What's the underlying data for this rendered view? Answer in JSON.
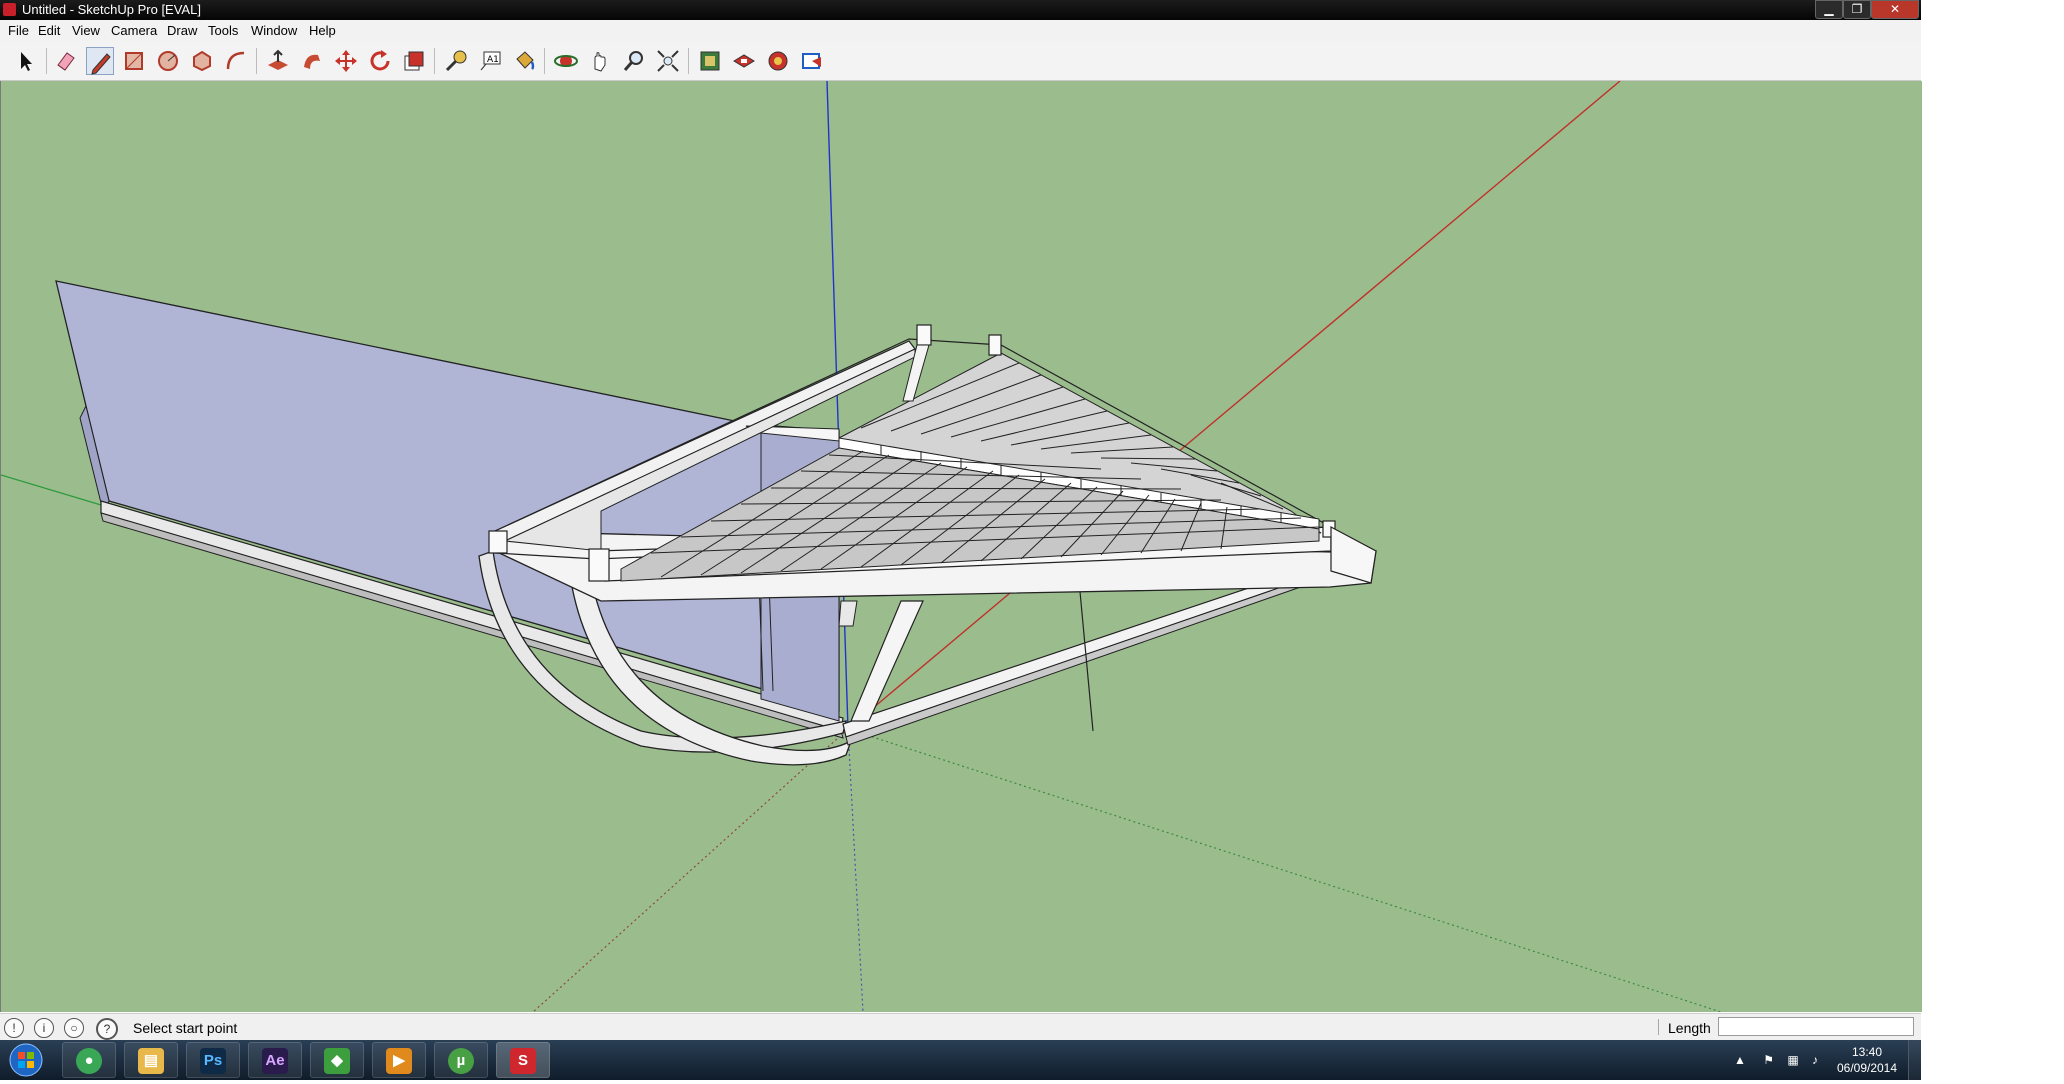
{
  "window": {
    "title": "Untitled - SketchUp Pro [EVAL]",
    "minimize": "▁",
    "restore": "❐",
    "close": "✕"
  },
  "menu": [
    "File",
    "Edit",
    "View",
    "Camera",
    "Draw",
    "Tools",
    "Window",
    "Help"
  ],
  "toolbar": {
    "tools": [
      "select-icon",
      "eraser-icon",
      "pencil-icon",
      "rectangle-icon",
      "circle-icon",
      "polygon-icon",
      "arc-icon",
      "push-pull-icon",
      "follow-me-icon",
      "move-icon",
      "rotate-icon",
      "scale-icon",
      "tape-measure-icon",
      "text-icon",
      "paint-bucket-icon",
      "orbit-icon",
      "pan-icon",
      "zoom-icon",
      "zoom-extents-icon",
      "warehouse-icon",
      "components-icon",
      "extension-icon",
      "layout-icon"
    ],
    "active": "pencil-icon"
  },
  "status": {
    "text": "Select start point",
    "length_label": "Length",
    "length_value": "",
    "icons": [
      "geo-location-icon",
      "credits-icon",
      "user-icon",
      "help-icon"
    ],
    "help_glyph": "?"
  },
  "taskbar": {
    "apps": [
      {
        "name": "chrome",
        "glyph": "●",
        "color": "#3aa757"
      },
      {
        "name": "explorer",
        "glyph": "▤",
        "color": "#e8b94a"
      },
      {
        "name": "photoshop",
        "glyph": "Ps",
        "color": "#0e2a47"
      },
      {
        "name": "after-effects",
        "glyph": "Ae",
        "color": "#2a1b4d"
      },
      {
        "name": "camtasia",
        "glyph": "◆",
        "color": "#3d9e3d"
      },
      {
        "name": "media-player",
        "glyph": "▶",
        "color": "#e08a1e"
      },
      {
        "name": "utorrent",
        "glyph": "µ",
        "color": "#47a043"
      },
      {
        "name": "sketchup",
        "glyph": "S",
        "color": "#d0262e"
      }
    ],
    "time": "13:40",
    "date": "06/09/2014",
    "tray_arrow": "▲"
  },
  "colors": {
    "viewport_bg": "#9bbd8e",
    "face": "#b0b5d6",
    "frame": "#f4f4f4",
    "edge": "#222222",
    "axis_red": "#c0302a",
    "axis_green": "#2c9a3a",
    "axis_blue": "#2233cc"
  }
}
